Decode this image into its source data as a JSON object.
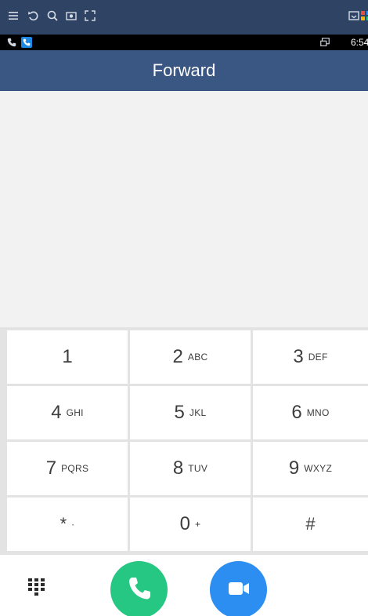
{
  "header": {
    "title": "Forward"
  },
  "status_bar": {
    "time": "6:54"
  },
  "nav_strip": {
    "icons": [
      "menu-icon",
      "undo-icon",
      "zoom-icon",
      "screenshot-icon",
      "fullscreen-icon",
      "cast-icon",
      "apps-icon"
    ]
  },
  "number_input": {
    "value": "",
    "placeholder": ""
  },
  "keypad": {
    "keys": [
      {
        "digit": "1",
        "letters": ""
      },
      {
        "digit": "2",
        "letters": "ABC"
      },
      {
        "digit": "3",
        "letters": "DEF"
      },
      {
        "digit": "4",
        "letters": "GHI"
      },
      {
        "digit": "5",
        "letters": "JKL"
      },
      {
        "digit": "6",
        "letters": "MNO"
      },
      {
        "digit": "7",
        "letters": "PQRS"
      },
      {
        "digit": "8",
        "letters": "TUV"
      },
      {
        "digit": "9",
        "letters": "WXYZ"
      },
      {
        "digit": "*",
        "letters": "·"
      },
      {
        "digit": "0",
        "letters": "+"
      },
      {
        "digit": "#",
        "letters": ""
      }
    ]
  },
  "actions": {
    "dialpad_icon": "dialpad-icon",
    "call_icon": "phone-icon",
    "video_icon": "video-camera-icon"
  },
  "colors": {
    "nav_strip": "#2f4364",
    "title_bar": "#3a5683",
    "call_button": "#25c783",
    "video_button": "#2b8ef0",
    "display_bg": "#f2f2f2"
  }
}
